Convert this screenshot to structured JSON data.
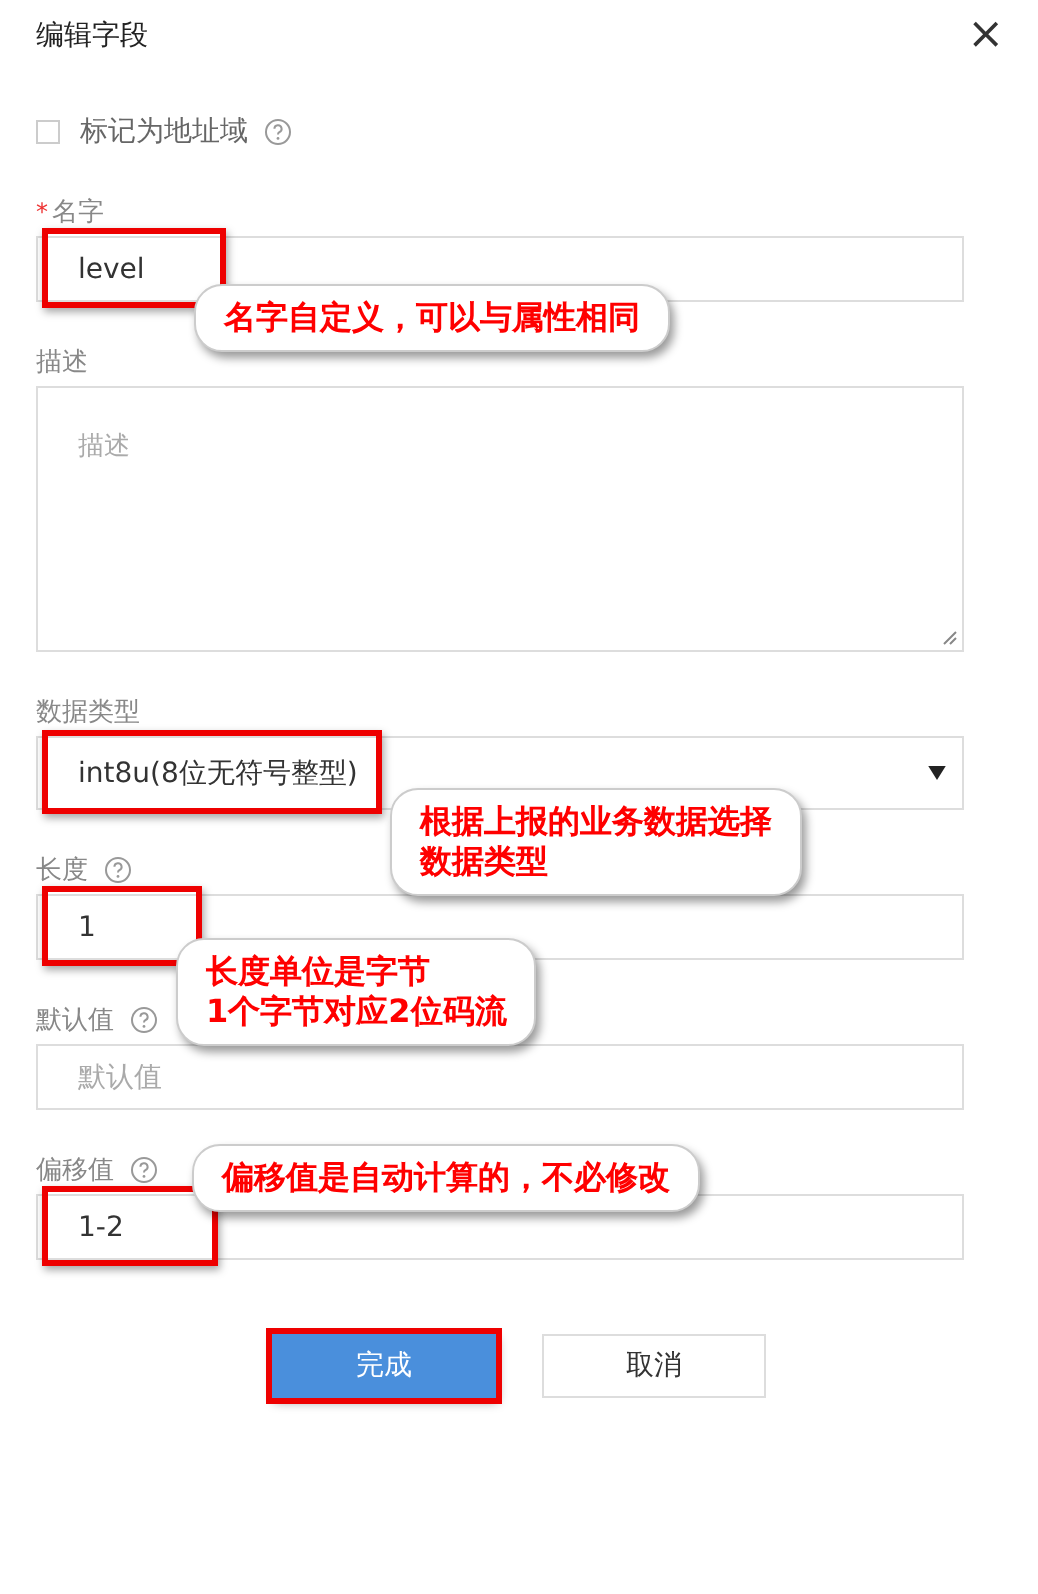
{
  "dialog": {
    "title": "编辑字段",
    "close": "×"
  },
  "checkbox": {
    "label": "标记为地址域",
    "checked": false,
    "help": true
  },
  "fields": [
    {
      "kind": "text",
      "label": "名字",
      "required_mark": "*",
      "help": false,
      "value": "level",
      "highlighted": true,
      "annotation": [
        "名字自定义，可以与属性相同"
      ]
    },
    {
      "kind": "textarea",
      "label": "描述",
      "help": false,
      "placeholder": "描述",
      "highlighted": false
    },
    {
      "kind": "select",
      "label": "数据类型",
      "help": false,
      "value": "int8u(8位无符号整型)",
      "highlighted": true,
      "annotation": [
        "根据上报的业务数据选择",
        "数据类型"
      ]
    },
    {
      "kind": "text",
      "label": "长度",
      "help": true,
      "value": "1",
      "highlighted": true,
      "annotation": [
        "长度单位是字节",
        "1个字节对应2位码流"
      ]
    },
    {
      "kind": "text",
      "label": "默认值",
      "help": true,
      "placeholder": "默认值",
      "highlighted": false
    },
    {
      "kind": "text",
      "label": "偏移值",
      "help": true,
      "value": "1-2",
      "highlighted": true,
      "annotation": [
        "偏移值是自动计算的，不必修改"
      ]
    }
  ],
  "buttons": [
    {
      "label": "完成",
      "primary": true,
      "highlighted": true
    },
    {
      "label": "取消",
      "primary": false,
      "highlighted": false
    }
  ]
}
